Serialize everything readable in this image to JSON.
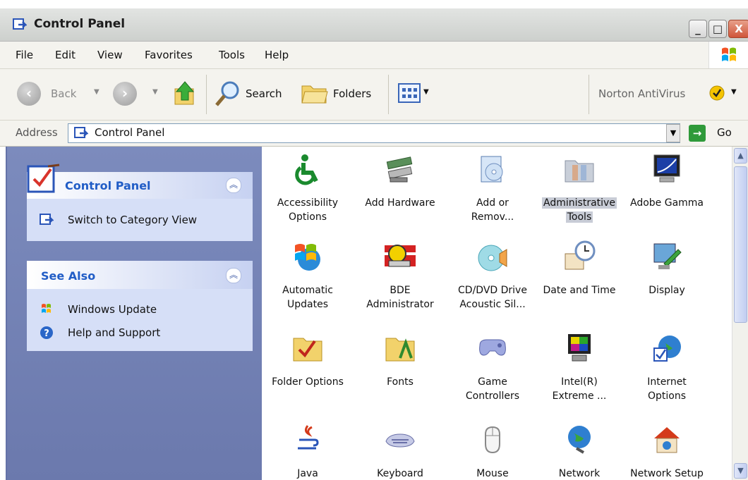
{
  "window": {
    "title": "Control Panel"
  },
  "menu": {
    "items": [
      "File",
      "Edit",
      "View",
      "Favorites",
      "Tools",
      "Help"
    ]
  },
  "toolbar": {
    "back": "Back",
    "search": "Search",
    "folders": "Folders",
    "norton": "Norton AntiVirus"
  },
  "address": {
    "label": "Address",
    "value": "Control Panel",
    "go": "Go"
  },
  "left": {
    "control_panel_title": "Control Panel",
    "switch_view": "Switch to Category View",
    "see_also_title": "See Also",
    "links": [
      "Windows Update",
      "Help and Support"
    ]
  },
  "items": [
    {
      "line1": "Accessibility",
      "line2": "Options",
      "icon": "accessibility-icon"
    },
    {
      "line1": "Add Hardware",
      "line2": "",
      "icon": "hardware-icon"
    },
    {
      "line1": "Add or",
      "line2": "Remov...",
      "icon": "add-remove-icon"
    },
    {
      "line1": "Administrative",
      "line2": "Tools",
      "icon": "admin-tools-icon"
    },
    {
      "line1": "Adobe Gamma",
      "line2": "",
      "icon": "monitor-icon"
    },
    {
      "line1": "Automatic",
      "line2": "Updates",
      "icon": "windows-update-icon"
    },
    {
      "line1": "BDE",
      "line2": "Administrator",
      "icon": "bde-icon"
    },
    {
      "line1": "CD/DVD Drive",
      "line2": "Acoustic Sil...",
      "icon": "cd-icon"
    },
    {
      "line1": "Date and Time",
      "line2": "",
      "icon": "clock-icon"
    },
    {
      "line1": "Display",
      "line2": "",
      "icon": "display-icon"
    },
    {
      "line1": "Folder Options",
      "line2": "",
      "icon": "folder-icon"
    },
    {
      "line1": "Fonts",
      "line2": "",
      "icon": "fonts-icon"
    },
    {
      "line1": "Game",
      "line2": "Controllers",
      "icon": "gamepad-icon"
    },
    {
      "line1": "Intel(R)",
      "line2": "Extreme ...",
      "icon": "intel-icon"
    },
    {
      "line1": "Internet",
      "line2": "Options",
      "icon": "globe-icon"
    },
    {
      "line1": "Java",
      "line2": "",
      "icon": "java-icon"
    },
    {
      "line1": "Keyboard",
      "line2": "",
      "icon": "keyboard-icon"
    },
    {
      "line1": "Mouse",
      "line2": "",
      "icon": "mouse-icon"
    },
    {
      "line1": "Network",
      "line2": "",
      "icon": "network-icon"
    },
    {
      "line1": "Network Setup",
      "line2": "",
      "icon": "home-network-icon"
    }
  ],
  "selected_item": "Administrative Tools",
  "colors": {
    "task_pane": "#7c8bbd",
    "link": "#215dc6",
    "selection": "#c8ccd6"
  }
}
